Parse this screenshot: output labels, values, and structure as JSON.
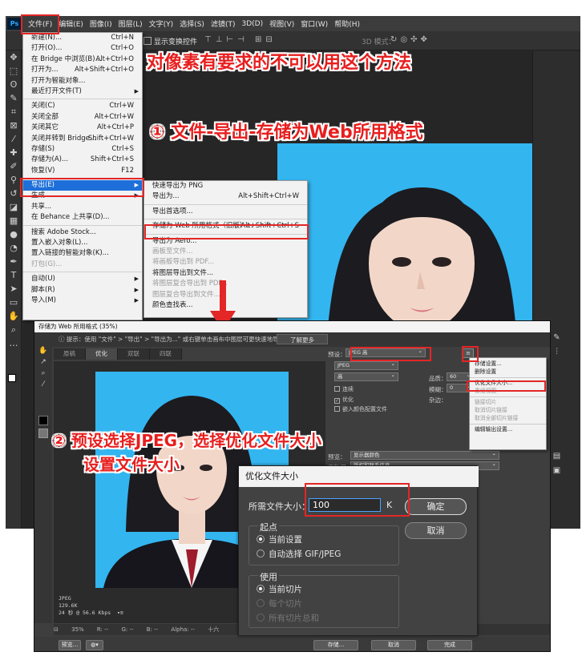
{
  "menubar": {
    "logo": "Ps",
    "items": [
      "文件(F)",
      "编辑(E)",
      "图像(I)",
      "图层(L)",
      "文字(Y)",
      "选择(S)",
      "滤镜(T)",
      "3D(D)",
      "视图(V)",
      "窗口(W)",
      "帮助(H)"
    ]
  },
  "options_bar": {
    "show_transform": "显示变换控件",
    "mode_3d": "3D 模式："
  },
  "file_menu": {
    "items": [
      {
        "label": "新建(N)...",
        "shortcut": "Ctrl+N"
      },
      {
        "label": "打开(O)...",
        "shortcut": "Ctrl+O"
      },
      {
        "label": "在 Bridge 中浏览(B)...",
        "shortcut": "Alt+Ctrl+O"
      },
      {
        "label": "打开为...",
        "shortcut": "Alt+Shift+Ctrl+O"
      },
      {
        "label": "打开为智能对象...",
        "shortcut": ""
      },
      {
        "label": "最近打开文件(T)",
        "shortcut": "",
        "submenu": true
      },
      {
        "sep": true
      },
      {
        "label": "关闭(C)",
        "shortcut": "Ctrl+W"
      },
      {
        "label": "关闭全部",
        "shortcut": "Alt+Ctrl+W"
      },
      {
        "label": "关闭其它",
        "shortcut": "Alt+Ctrl+P"
      },
      {
        "label": "关闭并转到 Bridge...",
        "shortcut": "Shift+Ctrl+W"
      },
      {
        "label": "存储(S)",
        "shortcut": "Ctrl+S"
      },
      {
        "label": "存储为(A)...",
        "shortcut": "Shift+Ctrl+S"
      },
      {
        "label": "恢复(V)",
        "shortcut": "F12"
      },
      {
        "sep": true
      },
      {
        "label": "导出(E)",
        "shortcut": "",
        "submenu": true,
        "highlight": true
      },
      {
        "label": "生成",
        "shortcut": "",
        "submenu": true
      },
      {
        "label": "共享...",
        "shortcut": ""
      },
      {
        "label": "在 Behance 上共享(D)...",
        "shortcut": ""
      },
      {
        "sep": true
      },
      {
        "label": "搜索 Adobe Stock...",
        "shortcut": ""
      },
      {
        "label": "置入嵌入对象(L)...",
        "shortcut": ""
      },
      {
        "label": "置入链接的智能对象(K)...",
        "shortcut": ""
      },
      {
        "label": "打包(G)...",
        "shortcut": "",
        "disabled": true
      },
      {
        "sep": true
      },
      {
        "label": "自动(U)",
        "shortcut": "",
        "submenu": true
      },
      {
        "label": "脚本(R)",
        "shortcut": "",
        "submenu": true
      },
      {
        "label": "导入(M)",
        "shortcut": "",
        "submenu": true
      }
    ]
  },
  "export_menu": {
    "items": [
      {
        "label": "快速导出为 PNG",
        "shortcut": ""
      },
      {
        "label": "导出为...",
        "shortcut": "Alt+Shift+Ctrl+W"
      },
      {
        "sep": true
      },
      {
        "label": "导出首选项...",
        "shortcut": ""
      },
      {
        "sep": true
      },
      {
        "label": "存储为 Web 所用格式（旧版）...",
        "shortcut": "Alt+Shift+Ctrl+S"
      },
      {
        "sep": true
      },
      {
        "label": "导出为 Aero...",
        "shortcut": ""
      },
      {
        "label": "画板至文件...",
        "shortcut": "",
        "disabled": true
      },
      {
        "label": "将画板导出到 PDF...",
        "shortcut": "",
        "disabled": true
      },
      {
        "label": "将图层导出到文件...",
        "shortcut": ""
      },
      {
        "label": "将图层复合导出到 PDF...",
        "shortcut": "",
        "disabled": true
      },
      {
        "label": "图层复合导出到文件...",
        "shortcut": "",
        "disabled": true
      },
      {
        "label": "颜色查找表...",
        "shortcut": ""
      }
    ]
  },
  "captions": {
    "warning": "对像素有要求的不可以用这个方法",
    "step1": "① 文件-导出-存储为Web所用格式",
    "step2_line1": "② 预设选择JPEG，选择优化文件大小",
    "step2_line2": "设置文件大小"
  },
  "sfw_dialog": {
    "title": "存储为 Web 所用格式 (35%)",
    "hint": "提示：使用 \"文件\" > \"导出\" > \"导出为...\" 或右键单击画布中图层可更快速地导出资源",
    "learn_more": "了解更多",
    "tabs": [
      "原稿",
      "优化",
      "双联",
      "四联"
    ],
    "preset_label": "预设：",
    "preset_value": "JPEG 高",
    "format_value": "JPEG",
    "quality_level": "高",
    "quality_label": "品质：",
    "quality_value": "60",
    "blur_label": "模糊：",
    "blur_value": "0",
    "matte_label": "杂边：",
    "progressive": "连续",
    "optimized": "优化",
    "embed_profile": "嵌入颜色配置文件",
    "preview_label": "预览：",
    "preview_value": "显示器颜色",
    "metadata_label": "元数据：",
    "metadata_value": "版权和联系信息",
    "file_info": "JPEG\n129.6K\n24 秒 @ 56.6 Kbps  ▾≡",
    "zoom": "35%",
    "r_label": "R: --",
    "g_label": "G: --",
    "b_label": "B: --",
    "alpha_label": "Alpha: --",
    "hex_label": "十六",
    "preview_btn": "预览...",
    "save_btn": "存储...",
    "cancel_btn": "取消",
    "done_btn": "完成"
  },
  "preset_menu": {
    "items": [
      {
        "label": "存储设置..."
      },
      {
        "label": "删除设置"
      },
      {
        "sep": true
      },
      {
        "label": "优化文件大小..."
      },
      {
        "label": "重组视图",
        "disabled": true
      },
      {
        "sep": true
      },
      {
        "label": "链接切片",
        "disabled": true
      },
      {
        "label": "取消切片链接",
        "disabled": true
      },
      {
        "label": "取消全部切片链接",
        "disabled": true
      },
      {
        "sep": true
      },
      {
        "label": "编辑输出设置..."
      }
    ]
  },
  "optimize_dialog": {
    "title": "优化文件大小",
    "size_label": "所需文件大小：",
    "size_value": "100",
    "unit": "K",
    "ok": "确定",
    "cancel": "取消",
    "start_group": "起点",
    "start_current": "当前设置",
    "start_auto": "自动选择 GIF/JPEG",
    "use_group": "使用",
    "use_current_slice": "当前切片",
    "use_each_slice": "每个切片",
    "use_all_slices": "所有切片总和"
  },
  "colors": {
    "background_blue": "#33b5f0",
    "annotation_red": "#e32626",
    "menu_highlight": "#1e6fd9"
  }
}
